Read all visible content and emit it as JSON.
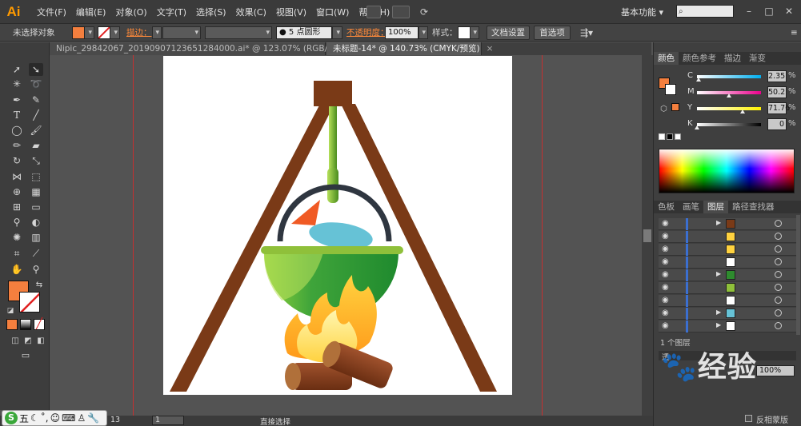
{
  "app": {
    "logo": "Ai"
  },
  "menus": [
    "文件(F)",
    "编辑(E)",
    "对象(O)",
    "文字(T)",
    "选择(S)",
    "效果(C)",
    "视图(V)",
    "窗口(W)",
    "帮助(H)"
  ],
  "workspace": "基本功能",
  "control": {
    "no_selection": "未选择对象",
    "stroke_label": "描边：",
    "brush_label": "5 点圆形",
    "opacity_label": "不透明度：",
    "opacity_value": "100%",
    "style_label": "样式：",
    "doc_setup": "文档设置",
    "preferences": "首选项"
  },
  "tabs": [
    {
      "label": "Nipic_29842067_20190907123651284000.ai* @ 123.07% (RGB/预览)",
      "active": false
    },
    {
      "label": "未标题-14* @ 140.73% (CMYK/预览)",
      "active": true
    }
  ],
  "tab_close": "×",
  "colors": {
    "fill": "#f47f3e",
    "wood": "#7a3a17",
    "pot_green": "#2e8b2e",
    "lime": "#8fc03a",
    "fish_blue": "#66c2d6",
    "flame_yellow": "#ffd23f",
    "flame_orange": "#ffb020"
  },
  "color_panel": {
    "tabs": [
      "颜色",
      "颜色参考",
      "描边",
      "渐变"
    ],
    "channels": [
      {
        "label": "C",
        "value": "2.35",
        "pct": 0.0235
      },
      {
        "label": "M",
        "value": "50.2",
        "pct": 0.502
      },
      {
        "label": "Y",
        "value": "71.76",
        "pct": 0.7176
      },
      {
        "label": "K",
        "value": "0",
        "pct": 0.0
      }
    ],
    "pct_sign": "%"
  },
  "layers_panel": {
    "tabs": [
      "色板",
      "画笔",
      "图层",
      "路径查找器"
    ],
    "footer": "1 个图层",
    "rows": [
      {
        "arrow": true,
        "thumb": "#7a3a17"
      },
      {
        "arrow": false,
        "thumb": "#ffd23f"
      },
      {
        "arrow": false,
        "thumb": "#ffd23f"
      },
      {
        "arrow": false,
        "thumb": "#ffffff"
      },
      {
        "arrow": true,
        "thumb": "#2e8b2e"
      },
      {
        "arrow": false,
        "thumb": "#8fc03a"
      },
      {
        "arrow": false,
        "thumb": "#ffffff"
      },
      {
        "arrow": true,
        "thumb": "#66c2d6"
      },
      {
        "arrow": true,
        "thumb": "#ffffff"
      }
    ]
  },
  "lower_panel": {
    "opacity_value": "100%",
    "option": "反相蒙版",
    "title": "透"
  },
  "watermark": "经验",
  "status": {
    "zoom": "13",
    "page": "1",
    "tool": "直接选择"
  },
  "ime": {
    "logo": "S",
    "mode": "五"
  }
}
